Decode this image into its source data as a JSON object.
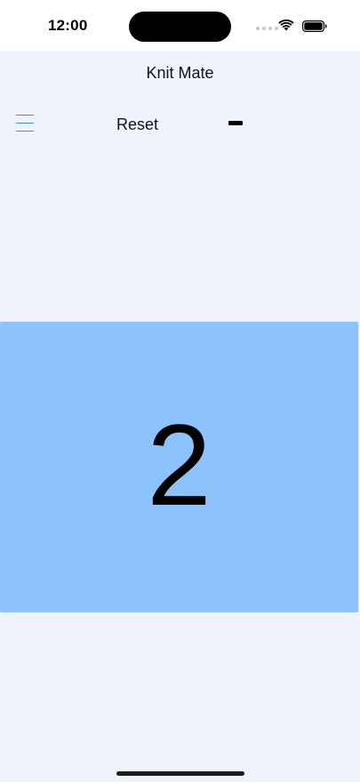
{
  "status_bar": {
    "time": "12:00",
    "icons": [
      "signal-dots-icon",
      "wifi-icon",
      "battery-icon"
    ]
  },
  "app": {
    "title": "Knit Mate"
  },
  "toolbar": {
    "menu_icon": "hamburger-menu-icon",
    "reset_label": "Reset",
    "decrement_icon": "minus-icon"
  },
  "counter": {
    "value": "2",
    "panel_color": "#8dc3fd"
  },
  "colors": {
    "background": "#eff4fc",
    "accent": "#4a88cf"
  }
}
